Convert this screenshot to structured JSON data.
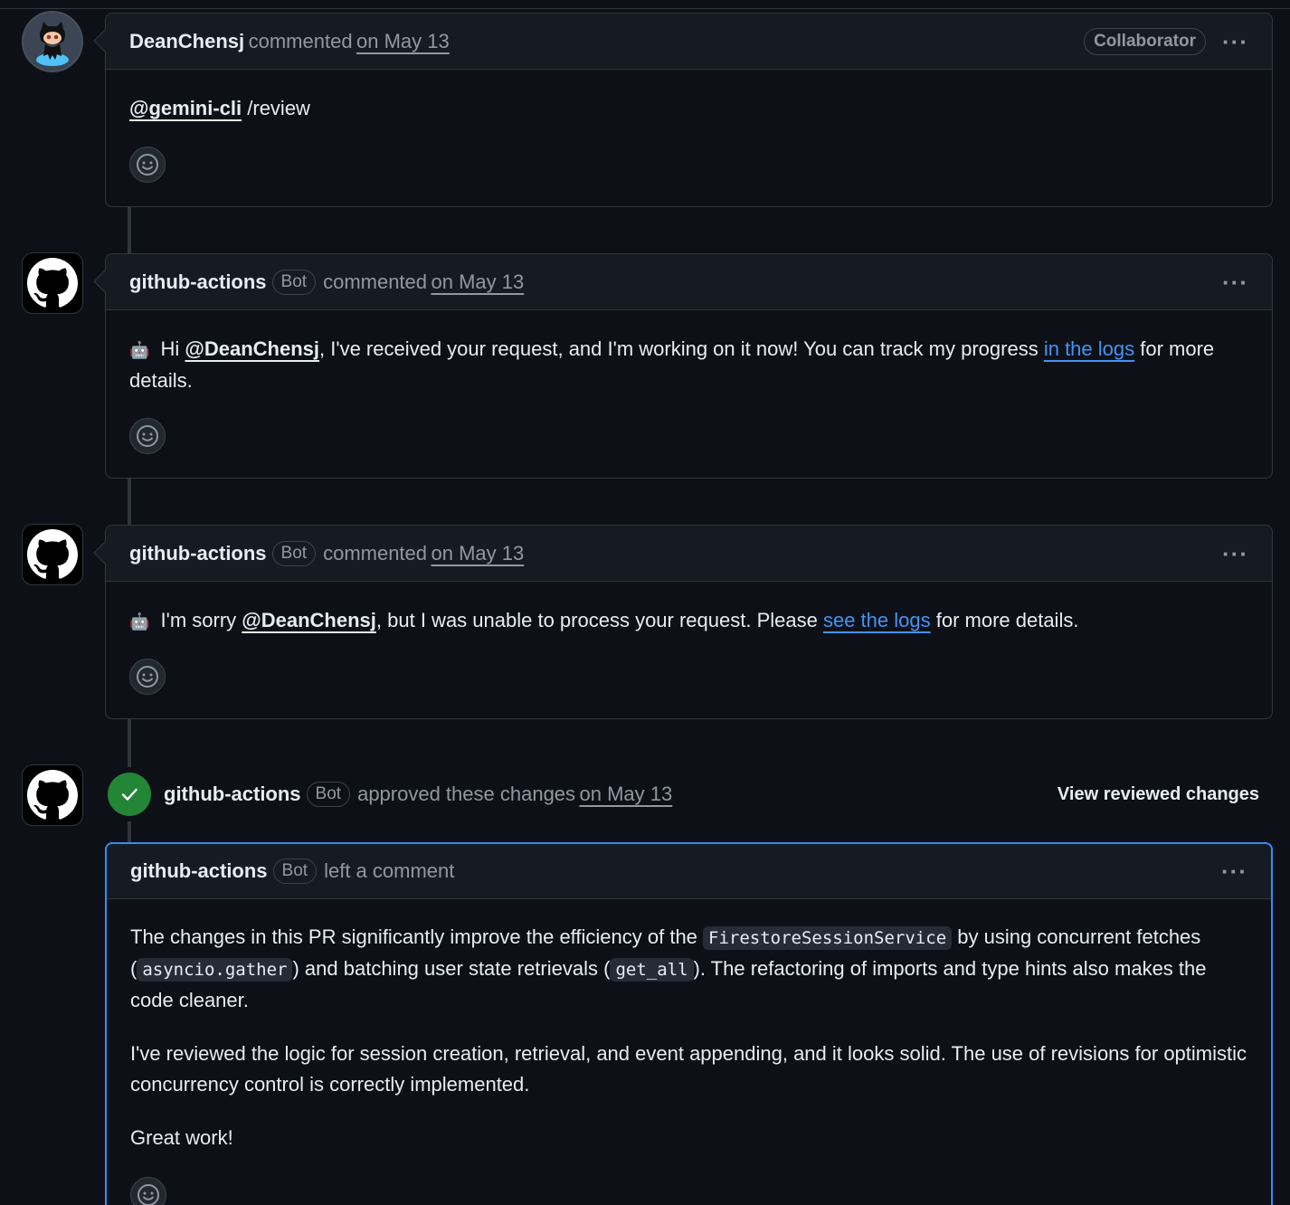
{
  "comments": [
    {
      "author": "DeanChensj",
      "action": "commented",
      "date": "on May 13",
      "role_badge": "Collaborator",
      "mention": "@gemini-cli",
      "text": " /review"
    },
    {
      "author": "github-actions",
      "bot_badge": "Bot",
      "action": "commented",
      "date": "on May 13",
      "prefix": " Hi ",
      "mention": "@DeanChensj",
      "text1": ", I've received your request, and I'm working on it now! You can track my progress ",
      "link": "in the logs",
      "text2": " for more details."
    },
    {
      "author": "github-actions",
      "bot_badge": "Bot",
      "action": "commented",
      "date": "on May 13",
      "prefix": " I'm sorry ",
      "mention": "@DeanChensj",
      "text1": ", but I was unable to process your request. Please ",
      "link": "see the logs",
      "text2": " for more details."
    }
  ],
  "review": {
    "author": "github-actions",
    "bot_badge": "Bot",
    "action": "approved these changes",
    "date": "on May 13",
    "view_changes": "View reviewed changes",
    "comment": {
      "author": "github-actions",
      "bot_badge": "Bot",
      "action": "left a comment",
      "p1_a": "The changes in this PR significantly improve the efficiency of the ",
      "p1_code1": "FirestoreSessionService",
      "p1_b": " by using concurrent fetches (",
      "p1_code2": "asyncio.gather",
      "p1_c": ") and batching user state retrievals (",
      "p1_code3": "get_all",
      "p1_d": "). The refactoring of imports and type hints also makes the code cleaner.",
      "p2": "I've reviewed the logic for session creation, retrieval, and event appending, and it looks solid. The use of revisions for optimistic concurrency control is correctly implemented.",
      "p3": "Great work!"
    }
  },
  "icons": {
    "avatar_user": "octocat-avatar-icon",
    "avatar_bot": "github-mark-icon",
    "reaction": "smiley-icon",
    "more": "kebab-horizontal-icon",
    "approved": "check-icon",
    "robot": "robot-icon"
  },
  "colors": {
    "background": "#0d1117",
    "header": "#151b23",
    "border": "#30363d",
    "link": "#4493f8",
    "approve": "#238636",
    "focus": "#388bfd"
  }
}
